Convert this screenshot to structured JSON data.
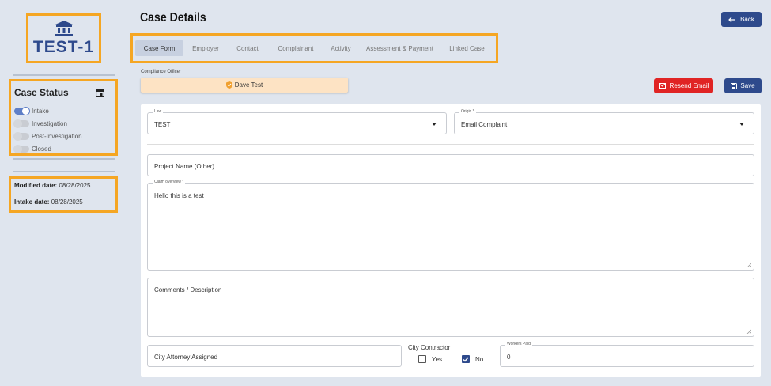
{
  "sidebar": {
    "case_id": "TEST-1",
    "status_title": "Case Status",
    "statuses": [
      {
        "label": "Intake",
        "on": true
      },
      {
        "label": "Investigation",
        "on": false
      },
      {
        "label": "Post-Investigation",
        "on": false
      },
      {
        "label": "Closed",
        "on": false
      }
    ],
    "modified_label": "Modified date:",
    "modified_value": "08/28/2025",
    "intake_label": "Intake date:",
    "intake_value": "08/28/2025"
  },
  "header": {
    "title": "Case Details",
    "back_label": "Back"
  },
  "tabs": [
    {
      "label": "Case Form",
      "active": true
    },
    {
      "label": "Employer",
      "active": false
    },
    {
      "label": "Contact",
      "active": false
    },
    {
      "label": "Complainant",
      "active": false
    },
    {
      "label": "Activity",
      "active": false
    },
    {
      "label": "Assessment & Payment",
      "active": false
    },
    {
      "label": "Linked Case",
      "active": false
    }
  ],
  "officer": {
    "label": "Compliance Officer",
    "name": "Dave Test"
  },
  "actions": {
    "resend_label": "Resend Email",
    "save_label": "Save"
  },
  "form": {
    "law_label": "Law",
    "law_value": "TEST",
    "origin_label": "Origin *",
    "origin_value": "Email Complaint",
    "project_placeholder": "Project Name (Other)",
    "claim_label": "Claim overview *",
    "claim_value": "Hello this is a test",
    "comments_placeholder": "Comments / Description",
    "attorney_placeholder": "City Attorney Assigned",
    "city_contractor_label": "City Contractor",
    "yes_label": "Yes",
    "no_label": "No",
    "contractor_yes": false,
    "contractor_no": true,
    "workers_paid_label": "Workers Paid",
    "workers_paid_value": "0"
  },
  "colors": {
    "accent": "#2e4a8c",
    "danger": "#e02424",
    "highlight": "#f5a623",
    "officer_bg": "#fde3c4"
  }
}
